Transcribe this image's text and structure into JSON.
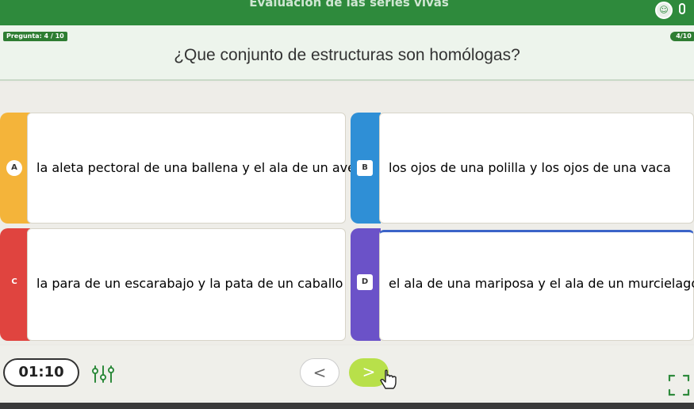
{
  "topbar": {
    "title": "Evaluación de las series vivas"
  },
  "question": {
    "counter_label": "Pregunta: 4 / 10",
    "counter_short": "4/10",
    "text": "¿Que conjunto de estructuras son homólogas?"
  },
  "options": [
    {
      "letter": "A",
      "text": "la aleta pectoral de una ballena y el ala de un ave",
      "color": "#f4b43a"
    },
    {
      "letter": "B",
      "text": "los ojos de una polilla y los ojos de una vaca",
      "color": "#2f8fd6"
    },
    {
      "letter": "C",
      "text": "la para de un escarabajo y la pata de un caballo",
      "color": "#e0443f"
    },
    {
      "letter": "D",
      "text": "el ala de una mariposa y el ala de un murcielago",
      "color": "#6b52c8"
    }
  ],
  "footer": {
    "timer": "01:10",
    "prev": "<",
    "next": ">"
  },
  "icons": {
    "settings": "sliders-icon",
    "user": "user-icon",
    "fullscreen": "fullscreen-icon",
    "cursor": "hand-cursor-icon"
  }
}
